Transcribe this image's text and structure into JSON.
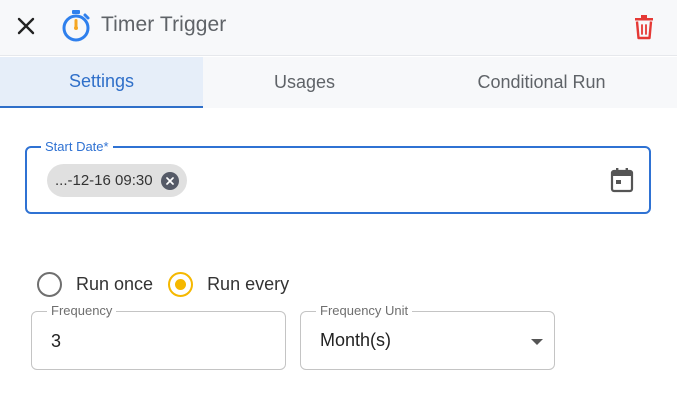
{
  "header": {
    "title": "Timer Trigger",
    "close_icon": "close-icon",
    "title_icon": "stopwatch-icon",
    "delete_icon": "trash-icon",
    "colors": {
      "stopwatch": "#2f80ed",
      "delete": "#e53935"
    }
  },
  "tabs": [
    {
      "label": "Settings",
      "active": true
    },
    {
      "label": "Usages",
      "active": false
    },
    {
      "label": "Conditional Run",
      "active": false
    }
  ],
  "start_date": {
    "label": "Start Date*",
    "chip_value": "...-12-16 09:30",
    "chip_remove_icon": "remove-chip-icon",
    "calendar_icon": "calendar-icon"
  },
  "run_mode": {
    "options": [
      {
        "label": "Run once",
        "selected": false
      },
      {
        "label": "Run every",
        "selected": true
      }
    ]
  },
  "frequency": {
    "label": "Frequency",
    "value": "3"
  },
  "frequency_unit": {
    "label": "Frequency Unit",
    "value": "Month(s)"
  },
  "colors": {
    "accent": "#2f72d3",
    "radio_selected": "#f5b800"
  }
}
